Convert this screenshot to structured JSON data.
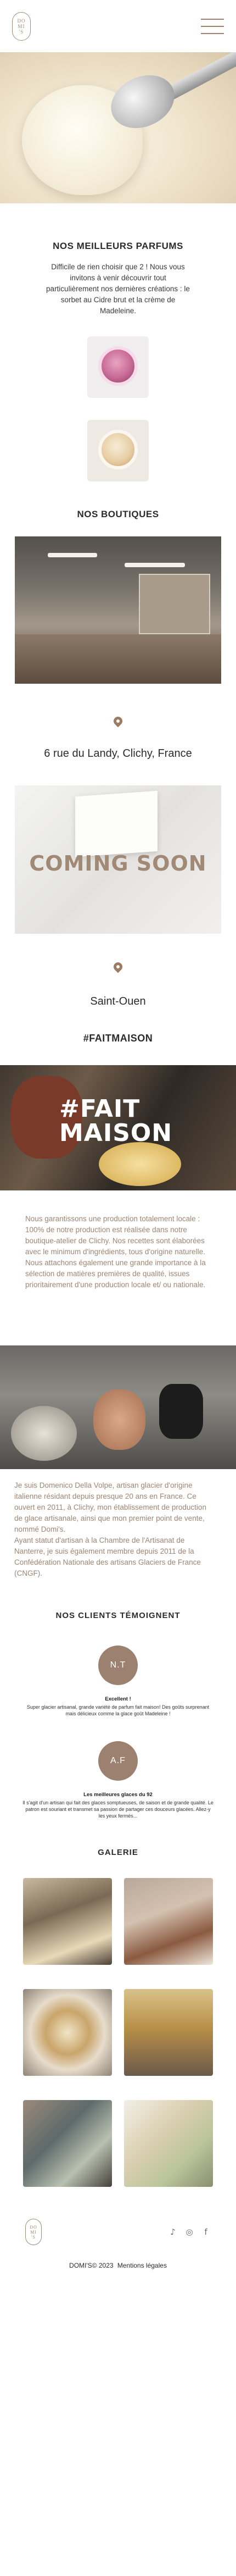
{
  "header": {
    "logo_text": [
      "DO",
      "MI",
      "'S"
    ],
    "menu_icon": "hamburger-menu-icon"
  },
  "flavours": {
    "title": "NOS MEILLEURS PARFUMS",
    "text": "Difficile de rien choisir que 2 ! Nous vous invitons à venir découvrir tout particulièrement nos dernières créations : le sorbet au Cidre brut et la crème de Madeleine."
  },
  "boutiques": {
    "title": "NOS BOUTIQUES",
    "address": "6 rue du Landy, Clichy, France",
    "coming_soon": "COMING SOON",
    "city": "Saint-Ouen",
    "pin_icon": "location-pin-icon"
  },
  "fait_maison": {
    "hashtag": "#FAITMAISON",
    "overlay_line1": "#FAIT",
    "overlay_line2": "MAISON",
    "text": "Nous garantissons une production totalement locale : 100% de notre production est réalisée dans notre boutique-atelier de Clichy. Nos recettes sont élaborées avec le minimum d'ingrédients, tous d'origine naturelle. Nous attachons également une grande importance à la sélection de matières premières de qualité, issues prioritairement d'une production locale et/ ou nationale."
  },
  "chef": {
    "p1": "Je suis Domenico Della Volpe, artisan glacier d'origine italienne résidant depuis presque 20 ans en France. Ce ouvert en 2011, à Clichy, mon établissement de production de glace artisanale, ainsi que mon premier point de vente, nommé Domi's.",
    "p2": "Ayant statut d'artisan à la Chambre de l'Artisanat de Nanterre, je suis également membre depuis 2011 de la Confédération Nationale des artisans Glaciers de France (CNGF)."
  },
  "reviews": {
    "title": "NOS CLIENTS TÉMOIGNENT",
    "items": [
      {
        "initials": "N.T",
        "name": "Excellent !",
        "text": "Super glacier artisanal, grande variété de parfum fait maison! Des goûts surprenant mais délicieux comme la glace goût Madeleine !"
      },
      {
        "initials": "A.F",
        "name": "Les meilleures glaces du 92",
        "text": "Il s'agit d'un artisan qui fait des glaces somptueuses, de saison et de grande qualité. Le patron est souriant et transmet sa passion de partager ces douceurs glacées. Allez-y les yeux fermés..."
      }
    ]
  },
  "gallery": {
    "title": "GALERIE",
    "items": [
      "gallery-photo-1",
      "gallery-photo-2",
      "gallery-photo-3",
      "gallery-photo-4",
      "gallery-photo-5",
      "gallery-photo-6"
    ]
  },
  "footer": {
    "socials": [
      {
        "name": "tiktok-icon",
        "glyph": "♪"
      },
      {
        "name": "instagram-icon",
        "glyph": "◎"
      },
      {
        "name": "facebook-icon",
        "glyph": "f"
      }
    ],
    "copyright": "DOMI'S© 2023",
    "legal_link": "Mentions légales"
  },
  "colors": {
    "accent": "#a08a76",
    "text_muted": "#9f8574",
    "avatar_bg": "#9c8070"
  }
}
